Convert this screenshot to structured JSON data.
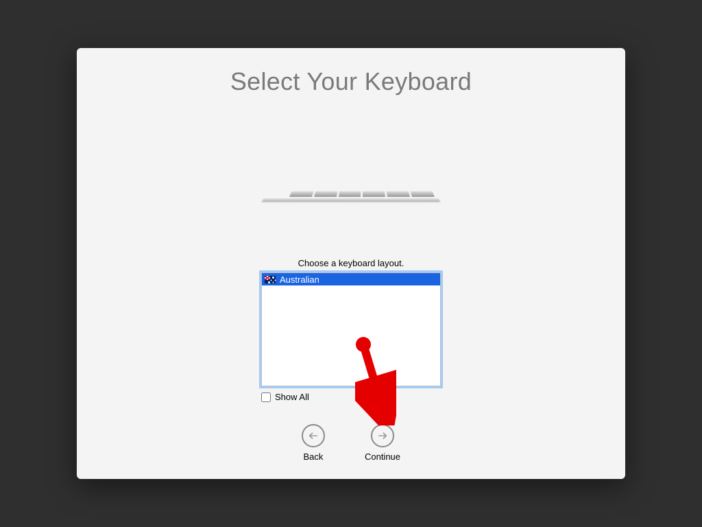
{
  "title": "Select Your Keyboard",
  "instruction": "Choose a keyboard layout.",
  "layouts": [
    {
      "name": "Australian",
      "selected": true
    }
  ],
  "showAll": {
    "label": "Show All",
    "checked": false
  },
  "nav": {
    "back": "Back",
    "continue": "Continue"
  }
}
